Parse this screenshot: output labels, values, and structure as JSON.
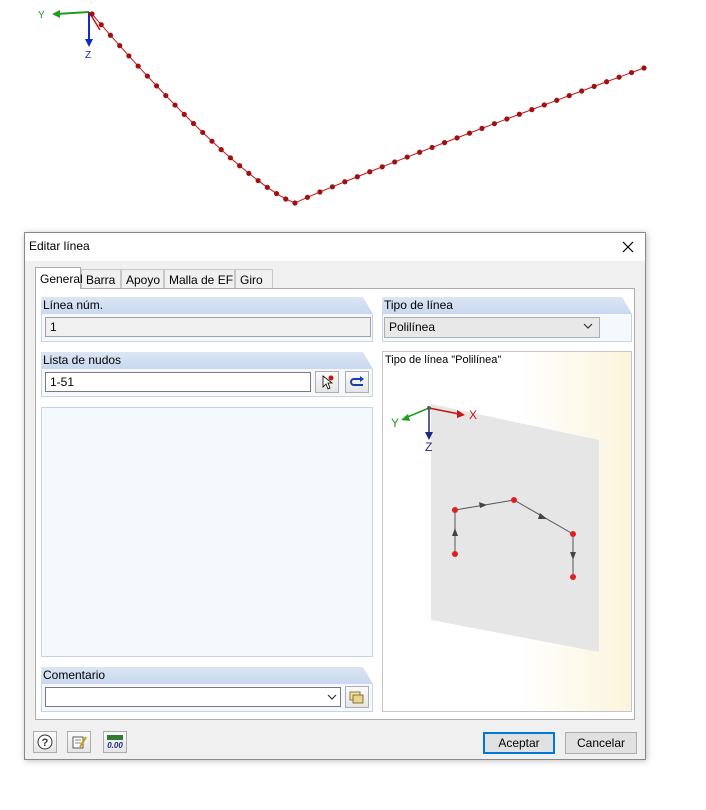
{
  "viewport": {
    "axis_y": "Y",
    "axis_z": "Z"
  },
  "dialog": {
    "title": "Editar línea",
    "tabs": [
      "General",
      "Barra",
      "Apoyo",
      "Malla de EF",
      "Giro"
    ],
    "active_tab": "General",
    "line_number": {
      "label": "Línea núm.",
      "value": "1"
    },
    "node_list": {
      "label": "Lista de nudos",
      "value": "1-51"
    },
    "comment": {
      "label": "Comentario",
      "value": ""
    },
    "line_type": {
      "label": "Tipo de línea",
      "value": "Polilínea"
    },
    "preview": {
      "caption": "Tipo de línea \"Polilínea\"",
      "axis_x": "X",
      "axis_y": "Y",
      "axis_z": "Z"
    },
    "buttons": {
      "ok": "Aceptar",
      "cancel": "Cancelar"
    },
    "footer_icons": [
      "help-icon",
      "edit-icon",
      "units-icon"
    ]
  }
}
